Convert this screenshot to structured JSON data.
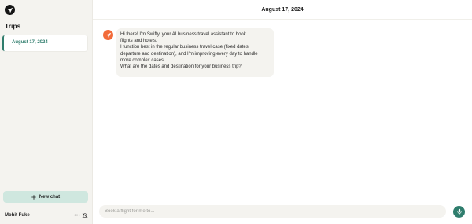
{
  "sidebar": {
    "title": "Trips",
    "trips": [
      {
        "label": "August 17, 2024",
        "selected": true
      }
    ],
    "new_chat_label": "New chat",
    "user_name": "Mohit Fuke",
    "icons": {
      "logo": "paper-plane-icon",
      "new_chat": "plus-icon",
      "more": "more-horizontal-icon",
      "notifications": "bell-off-icon"
    }
  },
  "header": {
    "date": "August 17, 2024"
  },
  "conversation": {
    "messages": [
      {
        "sender": "assistant",
        "avatar_icon": "paper-plane-icon",
        "lines": [
          "Hi there! I'm Swifty, your AI business travel assistant to book",
          "flights and hotels.",
          "I function best in the regular business travel case (fixed dates,",
          "departure and destination), and I'm improving every day to handle",
          "more complex cases.",
          "What are the dates and destination for your business trip?"
        ]
      }
    ]
  },
  "composer": {
    "placeholder": "Book a flight for me to...",
    "value": "",
    "mic_icon": "microphone-icon"
  },
  "colors": {
    "accent": "#2f7d6d",
    "bot_avatar": "#f26b3a",
    "new_chat_bg": "#cfe7df",
    "sidebar_bg": "#f4f3ef"
  }
}
